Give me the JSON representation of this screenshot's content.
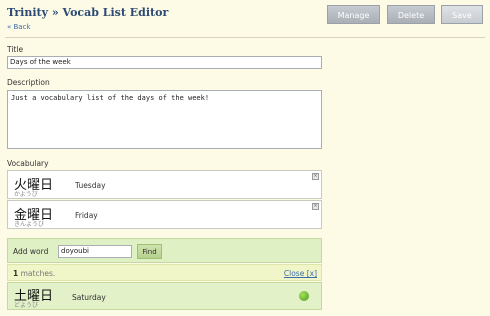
{
  "header": {
    "title": "Trinity » Vocab List Editor",
    "back_link": "« Back",
    "buttons": {
      "manage": "Manage",
      "delete": "Delete",
      "save": "Save"
    }
  },
  "form": {
    "title_label": "Title",
    "title_value": "Days of the week",
    "description_label": "Description",
    "description_value": "Just a vocabulary list of the days of the week!",
    "vocabulary_label": "Vocabulary"
  },
  "vocabulary": [
    {
      "kanji": "火曜日",
      "kana": "かようび",
      "meaning": "Tuesday"
    },
    {
      "kanji": "金曜日",
      "kana": "きんようび",
      "meaning": "Friday"
    }
  ],
  "add_word": {
    "label": "Add word",
    "input_value": "doyoubi",
    "find_label": "Find"
  },
  "results": {
    "count": "1",
    "matches_text": "matches.",
    "close_label": "Close [x]",
    "items": [
      {
        "kanji": "土曜日",
        "kana": "どようび",
        "meaning": "Saturday",
        "status": "available"
      }
    ]
  },
  "colors": {
    "title": "#2c4a73",
    "link": "#3b6ba8",
    "page_bg": "#fdfbe6",
    "add_panel_bg": "#dff0c4",
    "status_ok": "#4a9b1c"
  }
}
